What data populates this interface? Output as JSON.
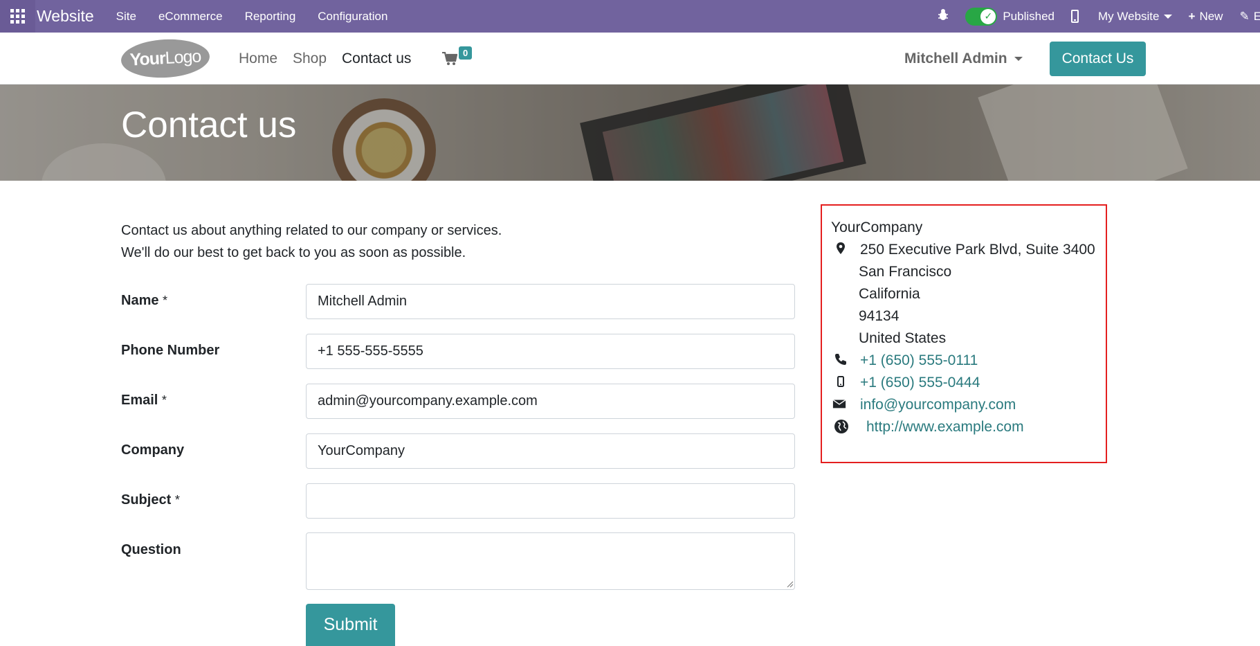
{
  "admin_bar": {
    "brand": "Website",
    "menu": [
      "Site",
      "eCommerce",
      "Reporting",
      "Configuration"
    ],
    "published_label": "Published",
    "my_website_label": "My Website",
    "new_label": "New",
    "edit_label": "Edit",
    "accent_color": "#71639e"
  },
  "header": {
    "logo_text_bold": "Your",
    "logo_text_light": "Logo",
    "nav": [
      "Home",
      "Shop",
      "Contact us"
    ],
    "active_nav": "Contact us",
    "cart_count": "0",
    "user_name": "Mitchell Admin",
    "contact_button": "Contact Us",
    "button_color": "#35979c"
  },
  "hero": {
    "title": "Contact us"
  },
  "intro": {
    "line1": "Contact us about anything related to our company or services.",
    "line2": "We'll do our best to get back to you as soon as possible."
  },
  "form": {
    "name_label": "Name",
    "name_value": "Mitchell Admin",
    "phone_label": "Phone Number",
    "phone_value": "+1 555-555-5555",
    "email_label": "Email",
    "email_value": "admin@yourcompany.example.com",
    "company_label": "Company",
    "company_value": "YourCompany",
    "subject_label": "Subject",
    "subject_value": "",
    "question_label": "Question",
    "required_mark": "*",
    "submit_label": "Submit"
  },
  "company_info": {
    "name": "YourCompany",
    "street": "250 Executive Park Blvd, Suite 3400",
    "city": "San Francisco",
    "state": "California",
    "zip": "94134",
    "country": "United States",
    "phone": "+1 (650) 555-0111",
    "mobile": "+1 (650) 555-0444",
    "email": "info@yourcompany.com",
    "website": "http://www.example.com",
    "icons": [
      "map-marker-icon",
      "phone-icon",
      "mobile-icon",
      "envelope-icon",
      "globe-icon"
    ],
    "highlight_color": "#e41f1f"
  }
}
